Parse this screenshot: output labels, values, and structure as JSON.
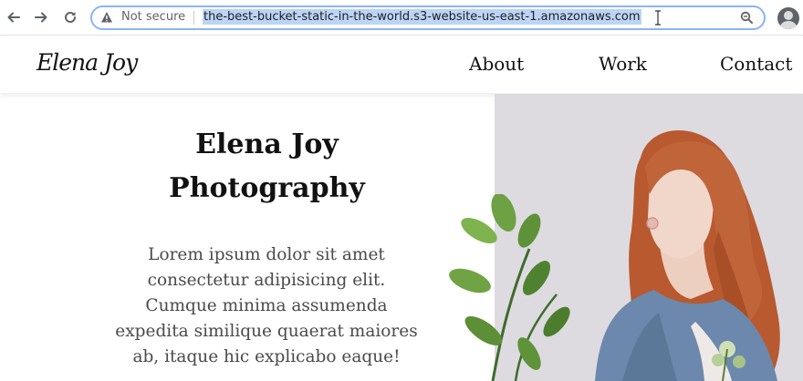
{
  "browser": {
    "security_label": "Not secure",
    "url": "the-best-bucket-static-in-the-world.s3-website-us-east-1.amazonaws.com"
  },
  "site": {
    "logo": "Elena Joy",
    "nav": [
      {
        "label": "About"
      },
      {
        "label": "Work"
      },
      {
        "label": "Contact"
      }
    ]
  },
  "hero": {
    "title_line1": "Elena Joy",
    "title_line2": "Photography",
    "body_lines": [
      "Lorem ipsum dolor sit amet",
      "consectetur adipisicing elit.",
      "Cumque minima assumenda",
      "expedita similique quaerat maiores",
      "ab, itaque hic explicabo eaque!"
    ]
  }
}
